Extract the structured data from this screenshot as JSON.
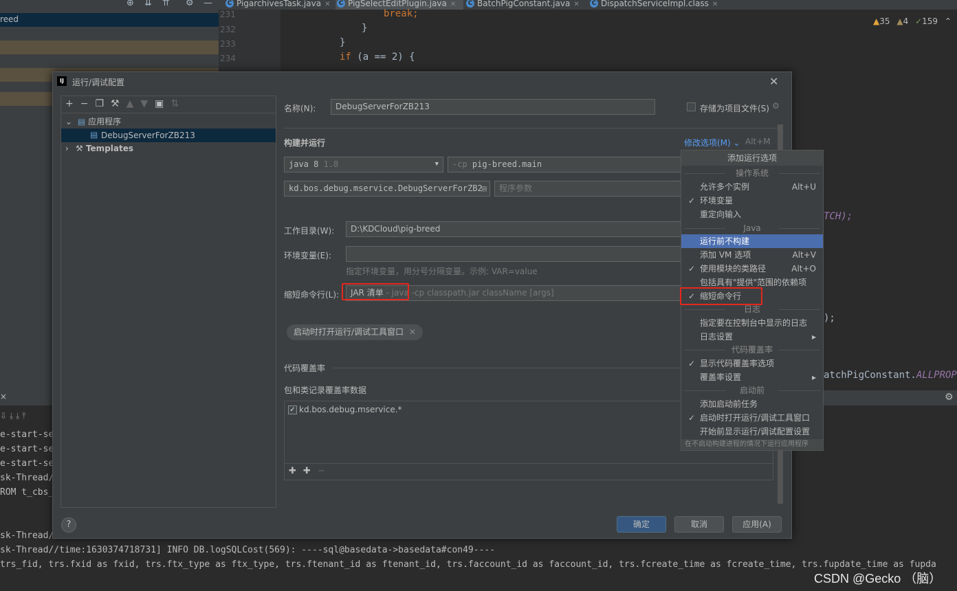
{
  "tabs": [
    {
      "label": "PigarchivesTask.java"
    },
    {
      "label": "PigSelectEditPlugin.java"
    },
    {
      "label": "BatchPigConstant.java"
    },
    {
      "label": "DispatchServiceImpl.class"
    }
  ],
  "project_panel": {
    "selected_label": "reed"
  },
  "editor": {
    "lines": [
      {
        "no": "231",
        "text": "break;"
      },
      {
        "no": "232",
        "text": "}"
      },
      {
        "no": "233",
        "text": "}"
      },
      {
        "no": "234",
        "kw": "if",
        "text": " (a == 2) {"
      }
    ],
    "inspections": {
      "warnings": "35",
      "weak": "4",
      "typos": "159"
    },
    "frag_tch": "TCH);",
    "frag_paren": ");",
    "frag_const": "atchPigConstant.",
    "frag_const_italic": "ALLPROPER"
  },
  "console": {
    "lines": [
      "e-start-se",
      "e-start-se",
      "e-start-se",
      "sk-Thread/",
      "ROM t_cbs_",
      "sk-Thread/",
      "sk-Thread//time:1630374718731] INFO DB.logSQLCost(569): ----sql@basedata->basedata#con49----",
      "trs_fid, trs.fxid as fxid, trs.ftx_type as ftx_type, trs.ftenant_id as ftenant_id, trs.faccount_id as faccount_id, trs.fcreate_time as fcreate_time, trs.fupdate_time as fupda"
    ]
  },
  "watermark": "CSDN @Gecko （脑）",
  "dialog": {
    "title": "运行/调试配置",
    "tree": {
      "group_app": "应用程序",
      "config_item": "DebugServerForZB213",
      "templates": "Templates"
    },
    "name_label": "名称(N):",
    "name_value": "DebugServerForZB213",
    "store_as_project_file": "存储为项目文件(S)",
    "build_run": "构建并运行",
    "modify_options": "修改选项(M)",
    "modify_shortcut": "Alt+M",
    "jre": "java 8",
    "jre_version": "1.8",
    "cp_prefix": "-cp",
    "cp_value": "pig-breed.main",
    "main_class": "kd.bos.debug.mservice.DebugServerForZB2",
    "program_args_placeholder": "程序参数",
    "workdir_label": "工作目录(W):",
    "workdir_value": "D:\\KDCloud\\pig-breed",
    "env_label": "环境变量(E):",
    "env_hint": "指定环境变量，用分号分隔变量。示例: VAR=value",
    "shorten_label": "缩短命令行(L):",
    "shorten_value": "JAR 清单",
    "shorten_dash": "- java",
    "shorten_hint": "-cp classpath.jar className [args]",
    "tag_open_tool_window": "启动时打开运行/调试工具窗口",
    "coverage_label": "代码覆盖率",
    "coverage_sub": "包和类记录覆盖率数据",
    "coverage_pattern": "kd.bos.debug.mservice.*",
    "buttons": {
      "ok": "确定",
      "cancel": "取消",
      "apply": "应用(A)"
    }
  },
  "menu": {
    "title": "添加运行选项",
    "sections": [
      {
        "header": "操作系统",
        "items": [
          {
            "label": "允许多个实例",
            "shortcut": "Alt+U",
            "checked": false
          },
          {
            "label": "环境变量",
            "shortcut": "",
            "checked": true
          },
          {
            "label": "重定向输入",
            "shortcut": "",
            "checked": false
          }
        ]
      },
      {
        "header": "Java",
        "items": [
          {
            "label": "运行前不构建",
            "shortcut": "",
            "checked": false,
            "selected": true
          },
          {
            "label": "添加 VM 选项",
            "shortcut": "Alt+V",
            "checked": false
          },
          {
            "label": "使用模块的类路径",
            "shortcut": "Alt+O",
            "checked": true
          },
          {
            "label": "包括具有\"提供\"范围的依赖项",
            "shortcut": "",
            "checked": false
          },
          {
            "label": "缩短命令行",
            "shortcut": "",
            "checked": true
          }
        ]
      },
      {
        "header": "日志",
        "items": [
          {
            "label": "指定要在控制台中显示的日志",
            "shortcut": "",
            "checked": false
          },
          {
            "label": "日志设置",
            "shortcut": "▸",
            "checked": false
          }
        ]
      },
      {
        "header": "代码覆盖率",
        "items": [
          {
            "label": "显示代码覆盖率选项",
            "shortcut": "",
            "checked": true
          },
          {
            "label": "覆盖率设置",
            "shortcut": "▸",
            "checked": false
          }
        ]
      },
      {
        "header": "启动前",
        "items": [
          {
            "label": "添加启动前任务",
            "shortcut": "",
            "checked": false
          },
          {
            "label": "启动时打开运行/调试工具窗口",
            "shortcut": "",
            "checked": true
          },
          {
            "label": "开始前显示运行/调试配置设置",
            "shortcut": "",
            "checked": false
          }
        ]
      }
    ],
    "footer": "在不启动构建进程的情况下运行应用程序"
  },
  "colors": {
    "accent": "#4b6eaf",
    "primary_button": "#365880",
    "highlight_box": "#e5271e"
  }
}
